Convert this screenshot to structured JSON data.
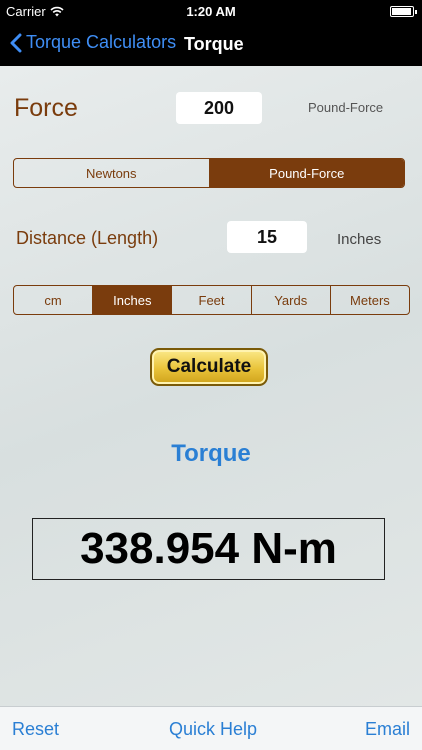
{
  "status_bar": {
    "carrier": "Carrier",
    "time": "1:20 AM"
  },
  "nav": {
    "back_label": "Torque Calculators",
    "title": "Torque"
  },
  "force": {
    "label": "Force",
    "value": "200",
    "unit": "Pound-Force",
    "options": [
      "Newtons",
      "Pound-Force"
    ],
    "selected": 1
  },
  "distance": {
    "label": "Distance (Length)",
    "value": "15",
    "unit": "Inches",
    "options": [
      "cm",
      "Inches",
      "Feet",
      "Yards",
      "Meters"
    ],
    "selected": 1
  },
  "calculate_label": "Calculate",
  "result": {
    "title": "Torque",
    "value": "338.954 N-m"
  },
  "toolbar": {
    "reset": "Reset",
    "help": "Quick Help",
    "email": "Email"
  },
  "colors": {
    "accent_brown": "#7a3c0d",
    "link_blue": "#2a7fd4",
    "ios_blue": "#3f8ef5",
    "button_gold": "#e9c33a"
  }
}
